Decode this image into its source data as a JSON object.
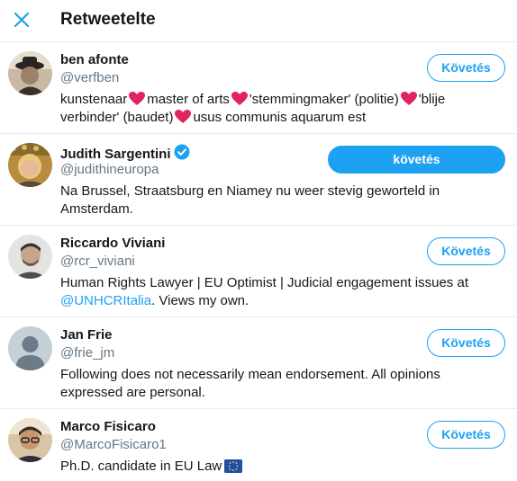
{
  "header": {
    "title": "Retweetelte",
    "close_icon": "close-icon"
  },
  "colors": {
    "accent": "#1da1f2",
    "secondary_text": "#657786",
    "heart": "#e0245e",
    "divider": "#e6ecf0"
  },
  "users": [
    {
      "name": "ben afonte",
      "handle": "@verfben",
      "button": "Követés",
      "bio_parts": [
        "kunstenaar",
        "master of arts",
        "'stemmingmaker' (politie)",
        "'blije verbinder' (baudet)",
        "usus communis aquarum est"
      ]
    },
    {
      "name": "Judith Sargentini",
      "verified": true,
      "handle": "@judithineuropa",
      "button": "követés",
      "bio": "Na Brussel, Straatsburg en Niamey nu weer stevig geworteld in Amsterdam."
    },
    {
      "name": "Riccardo Viviani",
      "handle": "@rcr_viviani",
      "button": "Követés",
      "bio_before": "Human Rights Lawyer | EU Optimist | Judicial engagement issues at ",
      "bio_link": "@UNHCRItalia",
      "bio_after": ". Views my own."
    },
    {
      "name": "Jan Frie",
      "handle": "@frie_jm",
      "button": "Követés",
      "bio": "Following does not necessarily mean endorsement. All opinions expressed are personal."
    },
    {
      "name": "Marco Fisicaro",
      "handle": "@MarcoFisicaro1",
      "button": "Követés",
      "bio": "Ph.D. candidate in EU Law"
    }
  ]
}
